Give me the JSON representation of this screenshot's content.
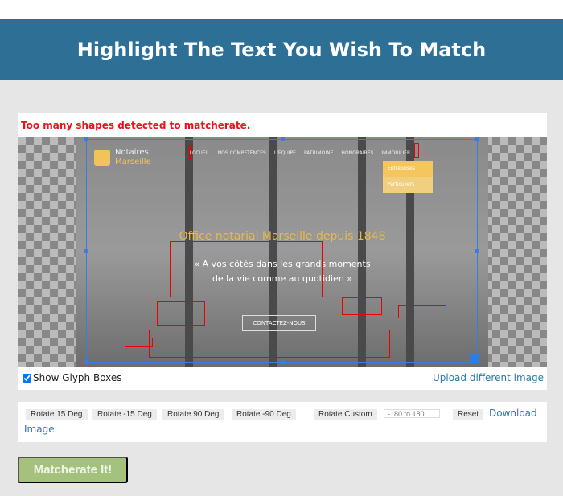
{
  "header": {
    "title": "Highlight The Text You Wish To Match"
  },
  "error": "Too many shapes detected to matcherate.",
  "preview": {
    "brand_line1": "Notaires",
    "brand_line2": "Marseille",
    "nav": [
      "ACCUEIL",
      "NOS COMPÉTENCES",
      "L'EQUIPE",
      "PATRIMOINE",
      "HONORAIRES",
      "IMMOBILIER"
    ],
    "dropdown": [
      "Entreprises",
      "Particuliers"
    ],
    "title": "Office notarial Marseille depuis 1848",
    "subtitle_line1": "« A vos côtés dans les grands moments",
    "subtitle_line2": "de la vie comme au quotidien »",
    "cta": "CONTACTEZ-NOUS"
  },
  "glyph_boxes": {
    "label": "Show Glyph Boxes",
    "checked": true
  },
  "upload_link": "Upload different image",
  "tools": {
    "rotate15": "Rotate 15 Deg",
    "rotate_m15": "Rotate -15 Deg",
    "rotate90": "Rotate 90 Deg",
    "rotate_m90": "Rotate -90 Deg",
    "rotate_custom": "Rotate Custom",
    "custom_placeholder": "-180 to 180",
    "reset": "Reset",
    "download1": "Download",
    "download2": "Image"
  },
  "submit": "Matcherate It!",
  "colors": {
    "header": "#2e6f96",
    "error": "#e8141b",
    "link": "#2e7aa8",
    "submit": "#a5c27c",
    "selection": "#3b7ddd"
  }
}
